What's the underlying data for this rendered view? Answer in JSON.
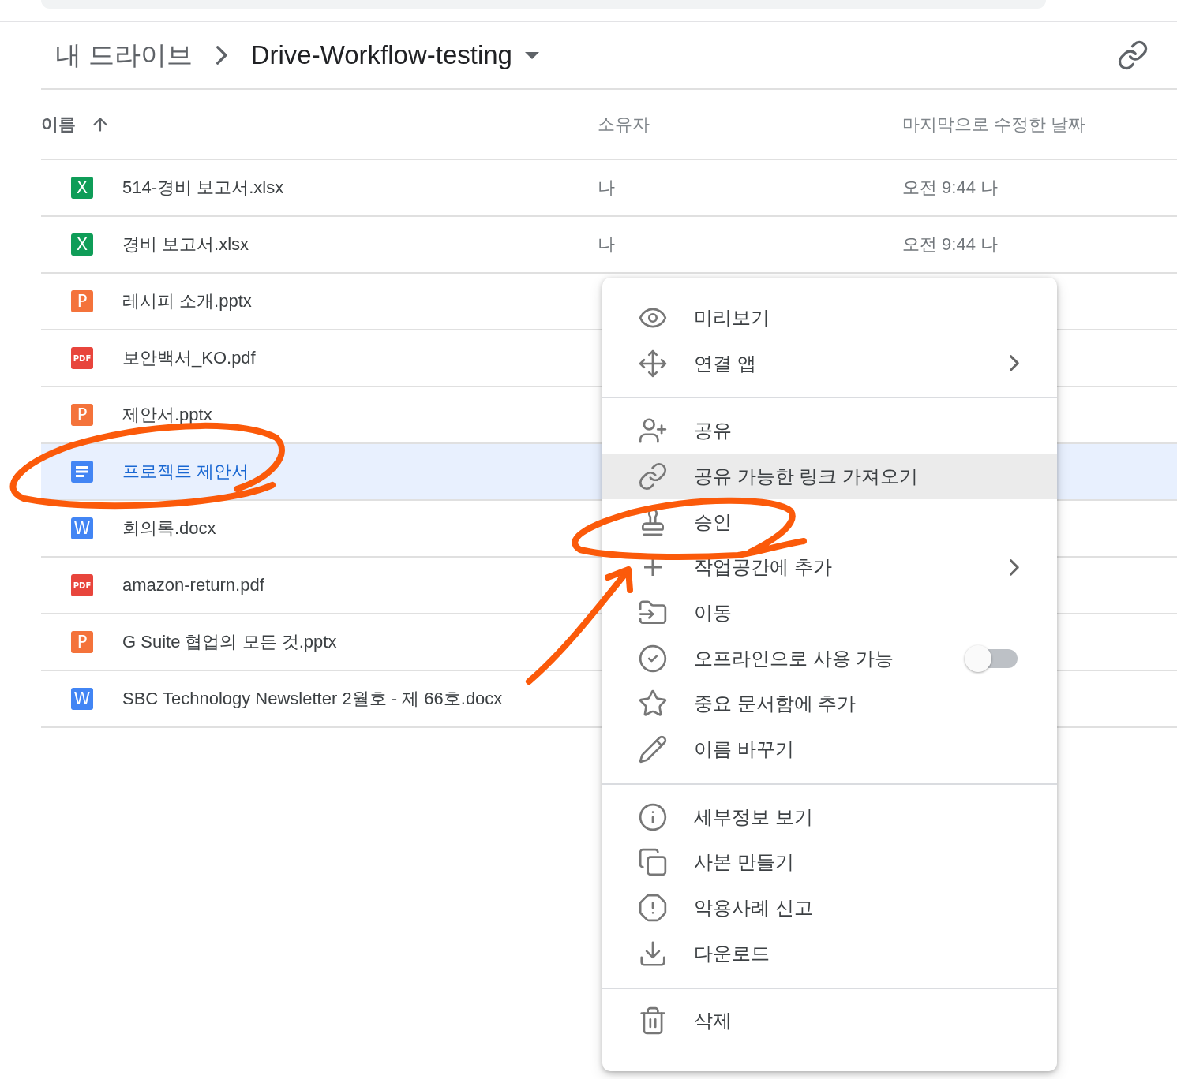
{
  "breadcrumb": {
    "root": "내 드라이브",
    "current": "Drive-Workflow-testing"
  },
  "table": {
    "columns": [
      {
        "label": "이름",
        "sorted": true
      },
      {
        "label": "소유자",
        "sorted": false
      },
      {
        "label": "마지막으로 수정한 날짜",
        "sorted": false
      }
    ],
    "rows": [
      {
        "kind": "sheet",
        "badge": "X",
        "name": "514-경비 보고서.xlsx",
        "owner": "나",
        "modified": "오전 9:44 나",
        "selected": false
      },
      {
        "kind": "sheet",
        "badge": "X",
        "name": "경비 보고서.xlsx",
        "owner": "나",
        "modified": "오전 9:44 나",
        "selected": false
      },
      {
        "kind": "slides",
        "badge": "P",
        "name": "레시피 소개.pptx",
        "selected": false
      },
      {
        "kind": "pdf",
        "badge": "PDF",
        "name": "보안백서_KO.pdf",
        "selected": false
      },
      {
        "kind": "slides",
        "badge": "P",
        "name": "제안서.pptx",
        "selected": false
      },
      {
        "kind": "doc",
        "name": "프로젝트 제안서",
        "selected": true
      },
      {
        "kind": "word",
        "badge": "W",
        "name": "회의록.docx",
        "selected": false
      },
      {
        "kind": "pdf",
        "badge": "PDF",
        "name": "amazon-return.pdf",
        "selected": false
      },
      {
        "kind": "slides",
        "badge": "P",
        "name": "G Suite 협업의 모든 것.pptx",
        "selected": false
      },
      {
        "kind": "word",
        "badge": "W",
        "name": "SBC Technology Newsletter 2월호 - 제 66호.docx",
        "selected": false
      }
    ]
  },
  "context_menu": {
    "groups": [
      [
        {
          "kind": "action",
          "label": "미리보기",
          "highlighted": false
        },
        {
          "kind": "submenu",
          "label": "연결 앱",
          "highlighted": false
        }
      ],
      [
        {
          "kind": "action",
          "label": "공유",
          "highlighted": false
        },
        {
          "kind": "action",
          "label": "공유 가능한 링크 가져오기",
          "highlighted": true
        },
        {
          "kind": "action",
          "label": "승인",
          "highlighted": false
        },
        {
          "kind": "submenu",
          "label": "작업공간에 추가",
          "highlighted": false
        },
        {
          "kind": "action",
          "label": "이동",
          "highlighted": false
        },
        {
          "kind": "toggle",
          "label": "오프라인으로 사용 가능",
          "highlighted": false,
          "on": false
        },
        {
          "kind": "action",
          "label": "중요 문서함에 추가",
          "highlighted": false
        },
        {
          "kind": "action",
          "label": "이름 바꾸기",
          "highlighted": false
        }
      ],
      [
        {
          "kind": "action",
          "label": "세부정보 보기",
          "highlighted": false
        },
        {
          "kind": "action",
          "label": "사본 만들기",
          "highlighted": false
        },
        {
          "kind": "action",
          "label": "악용사례 신고",
          "highlighted": false
        },
        {
          "kind": "action",
          "label": "다운로드",
          "highlighted": false
        }
      ],
      [
        {
          "kind": "action",
          "label": "삭제",
          "highlighted": false
        }
      ]
    ]
  }
}
